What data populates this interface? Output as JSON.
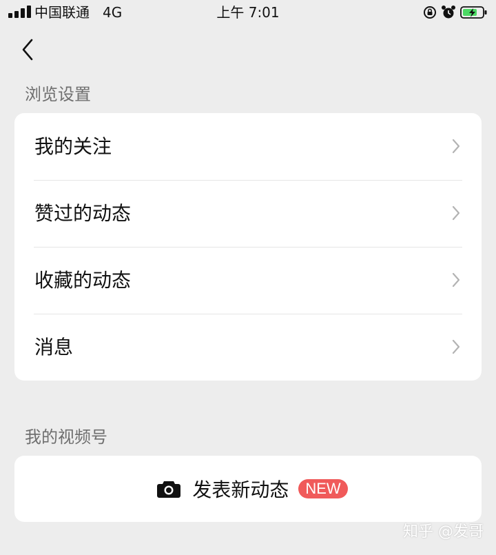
{
  "status_bar": {
    "carrier": "中国联通",
    "network": "4G",
    "time": "上午 7:01",
    "icons": [
      "signal-icon",
      "rotation-lock-icon",
      "alarm-icon",
      "battery-charging-icon"
    ]
  },
  "nav": {
    "back_icon": "chevron-left-icon"
  },
  "browse_settings": {
    "title": "浏览设置",
    "items": [
      {
        "label": "我的关注"
      },
      {
        "label": "赞过的动态"
      },
      {
        "label": "收藏的动态"
      },
      {
        "label": "消息"
      }
    ]
  },
  "my_channel": {
    "title": "我的视频号",
    "post_label": "发表新动态",
    "badge": "NEW",
    "icon": "camera-icon"
  },
  "watermark": "知乎 @发哥",
  "colors": {
    "background": "#ededed",
    "card": "#ffffff",
    "section_text": "#6f6f6f",
    "badge": "#f05a5a",
    "battery": "#4cd964"
  }
}
